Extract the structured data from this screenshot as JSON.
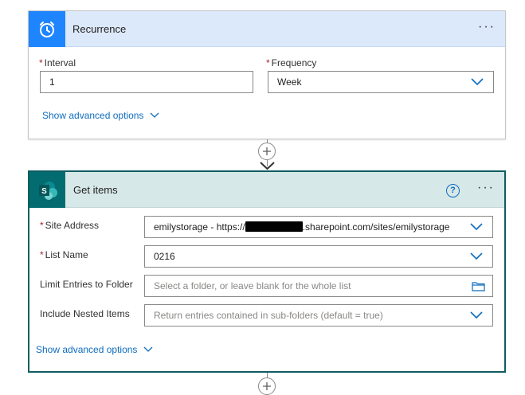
{
  "recurrence": {
    "title": "Recurrence",
    "more_label": "···",
    "interval_label": "Interval",
    "interval_value": "1",
    "frequency_label": "Frequency",
    "frequency_value": "Week",
    "advanced_label": "Show advanced options"
  },
  "connector": {
    "add_symbol": "+"
  },
  "get_items": {
    "title": "Get items",
    "help_label": "?",
    "more_label": "···",
    "site_label": "Site Address",
    "site_value_prefix": "emilystorage - https://",
    "site_value_suffix": ".sharepoint.com/sites/emilystorage",
    "list_label": "List Name",
    "list_value": "0216",
    "limit_label": "Limit Entries to Folder",
    "limit_placeholder": "Select a folder, or leave blank for the whole list",
    "nested_label": "Include Nested Items",
    "nested_placeholder": "Return entries contained in sub-folders (default = true)",
    "advanced_label": "Show advanced options"
  },
  "colors": {
    "recurrence_accent": "#1f85ff",
    "sharepoint_accent": "#036c70",
    "link": "#0f6cbd",
    "required": "#a4262c"
  },
  "icons": {
    "recurrence": "alarm-clock-icon",
    "sharepoint": "sharepoint-icon",
    "dropdown": "chevron-down-icon",
    "folder": "folder-icon"
  }
}
